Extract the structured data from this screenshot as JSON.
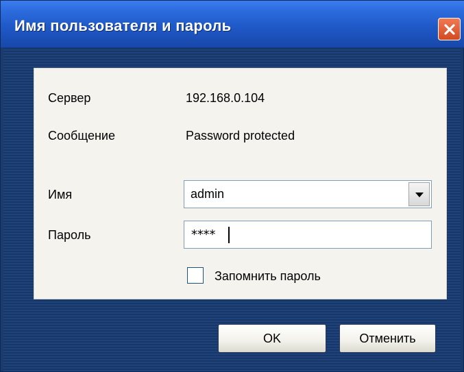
{
  "window": {
    "title": "Имя пользователя и пароль",
    "close_symbol": "✕"
  },
  "info": {
    "server_label": "Сервер",
    "server_value": "192.168.0.104",
    "message_label": "Сообщение",
    "message_value": "Password protected"
  },
  "form": {
    "username_label": "Имя",
    "username_value": "admin",
    "password_label": "Пароль",
    "password_value": "****",
    "remember_label": "Запомнить пароль",
    "remember_checked": false
  },
  "buttons": {
    "ok_label": "OK",
    "cancel_label": "Отменить"
  },
  "icons": {
    "close": "close-icon",
    "dropdown": "chevron-down-icon"
  },
  "colors": {
    "titlebar": "#1f59c8",
    "close_button": "#d24a22",
    "window_body": "#1d3a6e",
    "panel": "#f4f3ee"
  }
}
